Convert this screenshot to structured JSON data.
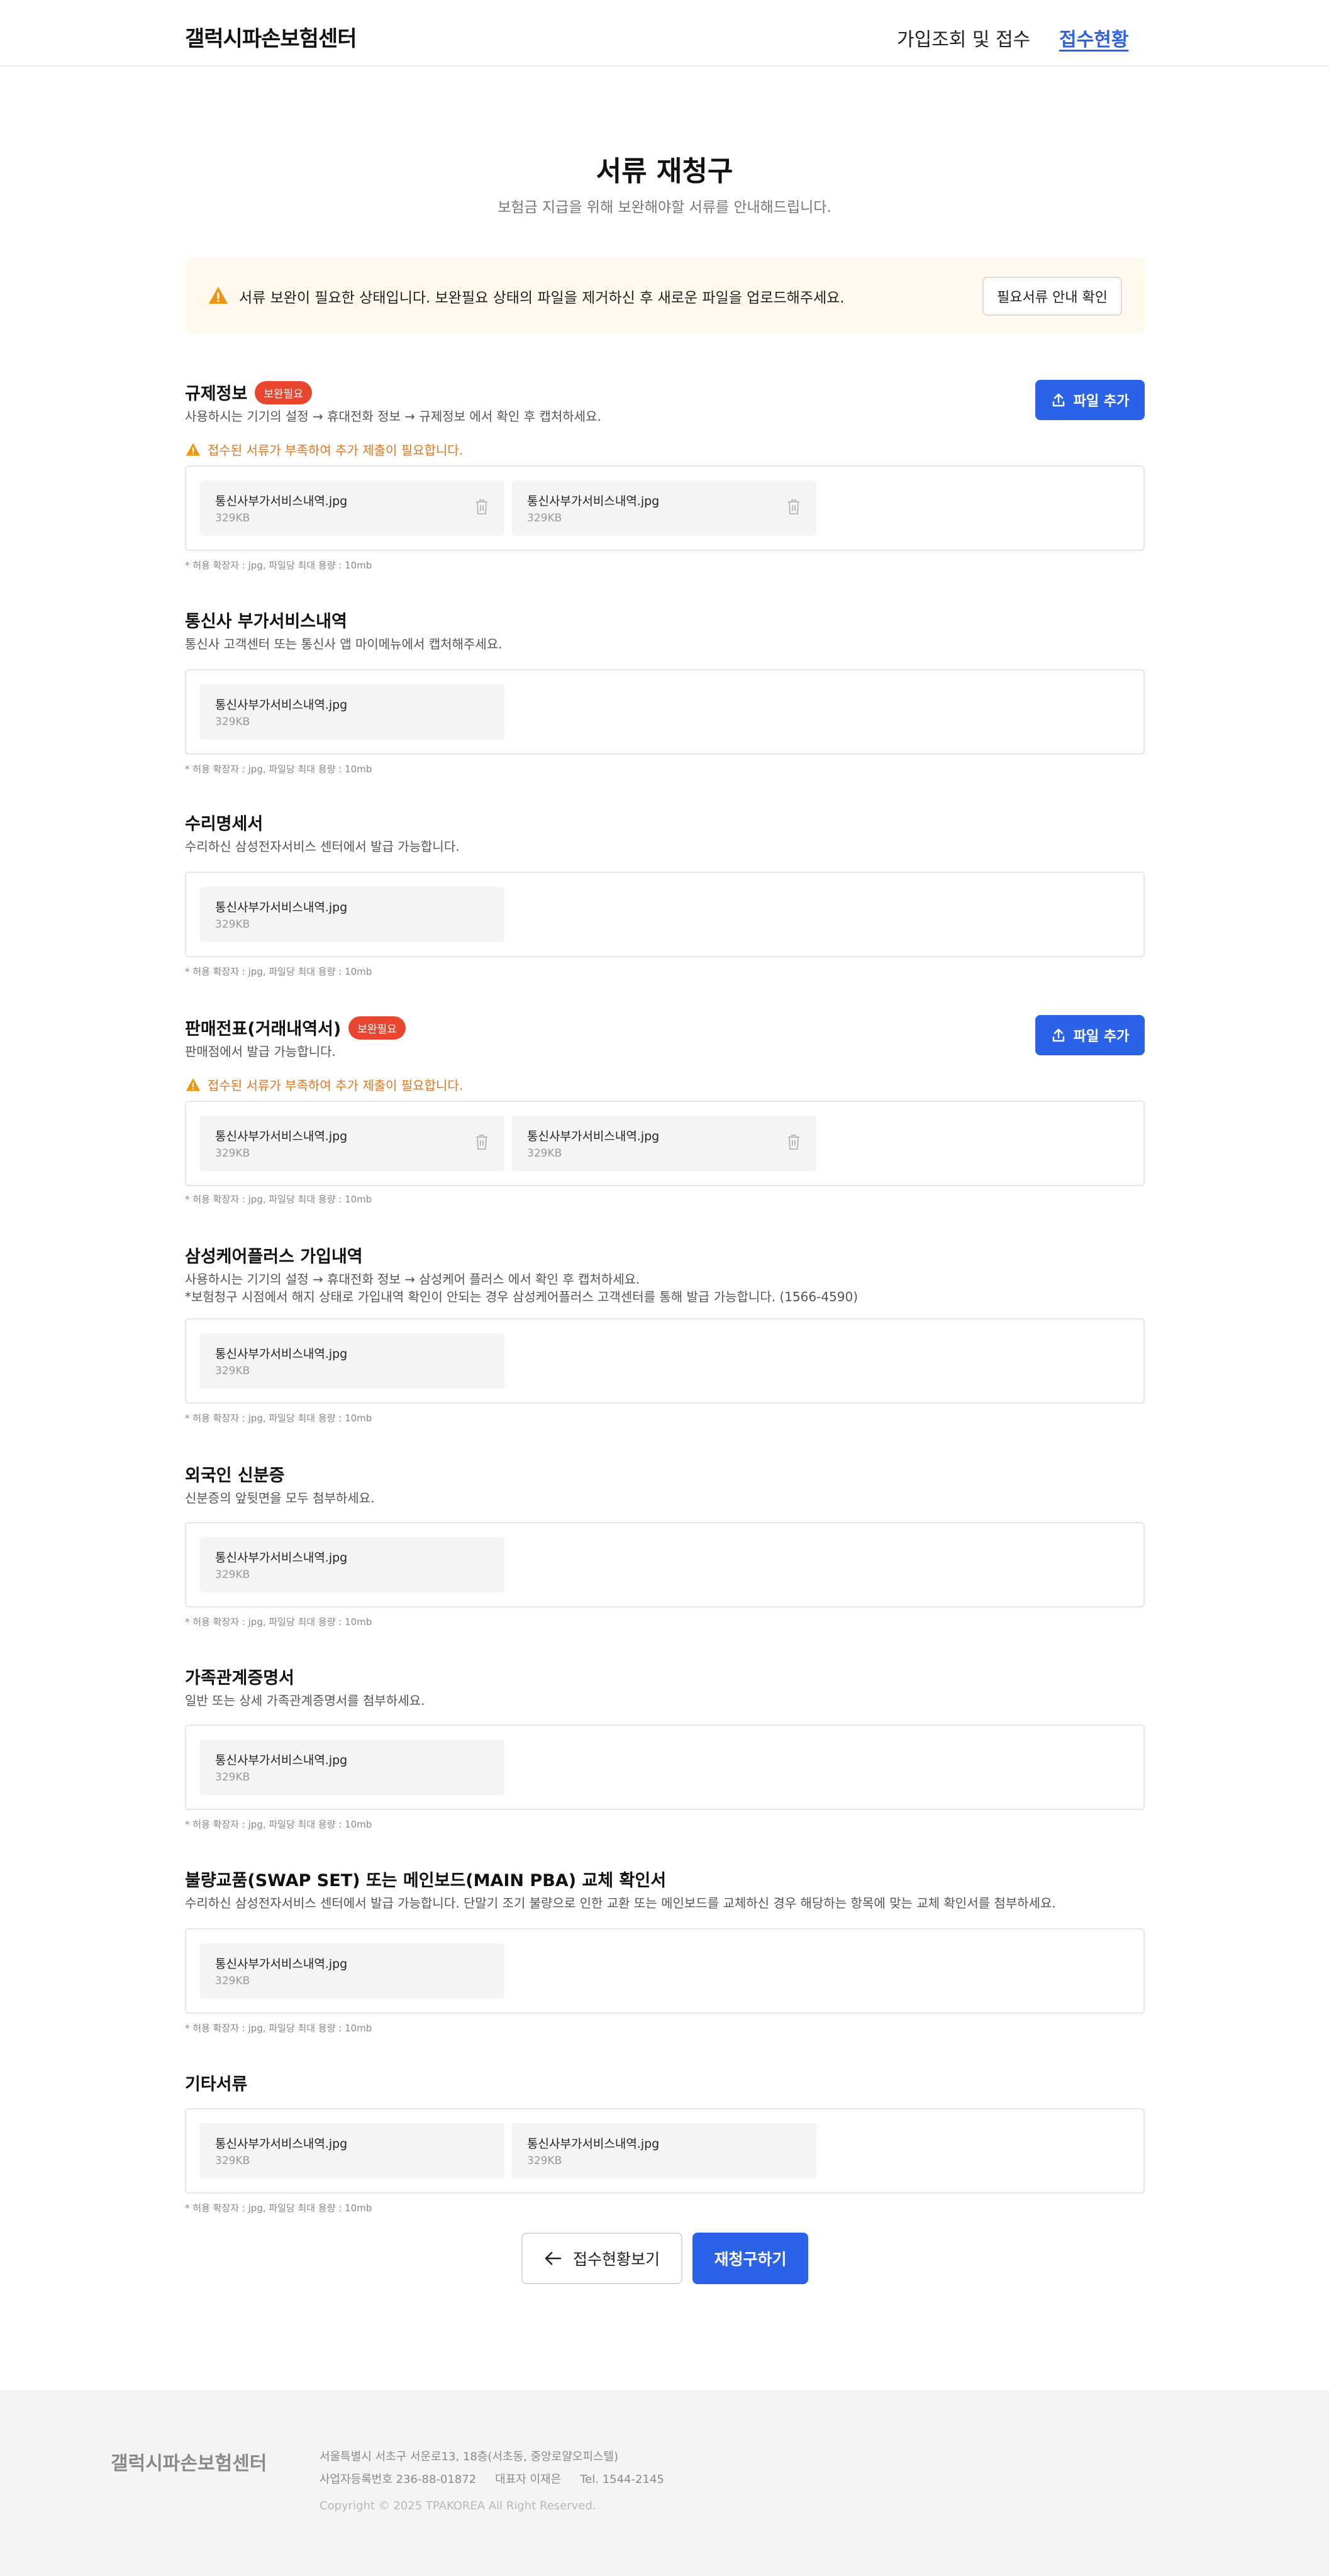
{
  "header": {
    "logo": "갤럭시파손보험센터",
    "nav_join": "가입조회 및 접수",
    "nav_status": "접수현황"
  },
  "page": {
    "title": "서류 재청구",
    "subtitle": "보험금 지급을 위해 보완해야할 서류를 안내해드립니다."
  },
  "notice": {
    "text": "서류 보완이 필요한 상태입니다. 보완필요 상태의 파일을 제거하신 후 새로운 파일을 업로드해주세요.",
    "button": "필요서류 안내 확인"
  },
  "common": {
    "badge": "보완필요",
    "add_file": "파일 추가",
    "warning": "접수된 서류가 부족하여 추가 제출이 필요합니다.",
    "hint": "* 허용 확장자 : jpg, 파일당 최대 용량 : 10mb",
    "file_name": "통신사부가서비스내역.jpg",
    "file_size": "329KB"
  },
  "sections": [
    {
      "title": "규제정보",
      "desc": "사용하시는 기기의 설정 → 휴대전화 정보 → 규제정보 에서 확인 후 캡처하세요."
    },
    {
      "title": "통신사 부가서비스내역",
      "desc": "통신사 고객센터 또는 통신사 앱 마이메뉴에서 캡처해주세요."
    },
    {
      "title": "수리명세서",
      "desc": "수리하신 삼성전자서비스 센터에서 발급 가능합니다."
    },
    {
      "title": "판매전표(거래내역서)",
      "desc": "판매점에서 발급 가능합니다."
    },
    {
      "title": "삼성케어플러스 가입내역",
      "desc": "사용하시는 기기의 설정 → 휴대전화 정보 → 삼성케어 플러스 에서 확인 후 캡처하세요.",
      "desc2": "*보험청구 시점에서 해지 상태로 가입내역 확인이 안되는 경우 삼성케어플러스 고객센터를 통해 발급 가능합니다. (1566-4590)"
    },
    {
      "title": "외국인 신분증",
      "desc": "신분증의 앞뒷면을 모두 첨부하세요."
    },
    {
      "title": "가족관계증명서",
      "desc": "일반 또는 상세 가족관계증명서를 첨부하세요."
    },
    {
      "title": "불량교품(SWAP SET) 또는 메인보드(MAIN PBA) 교체 확인서",
      "desc": "수리하신 삼성전자서비스 센터에서 발급 가능합니다. 단말기 조기 불량으로 인한 교환 또는 메인보드를 교체하신 경우 해당하는 항목에 맞는 교체 확인서를 첨부하세요."
    },
    {
      "title": "기타서류",
      "desc": ""
    }
  ],
  "actions": {
    "back": "접수현황보기",
    "submit": "재청구하기"
  },
  "footer": {
    "logo": "갤럭시파손보험센터",
    "address": "서울특별시 서초구 서운로13, 18층(서초동, 중앙로얄오피스텔)",
    "biz_no": "사업자등록번호 236-88-01872",
    "ceo": "대표자 이재은",
    "tel": "Tel. 1544-2145",
    "copyright": "Copyright © 2025 TPAKOREA All Right Reserved."
  },
  "colors": {
    "primary": "#2b63e8",
    "badge": "#e9462f",
    "warning": "#e8741c",
    "notice_bg": "#fff8ec"
  }
}
